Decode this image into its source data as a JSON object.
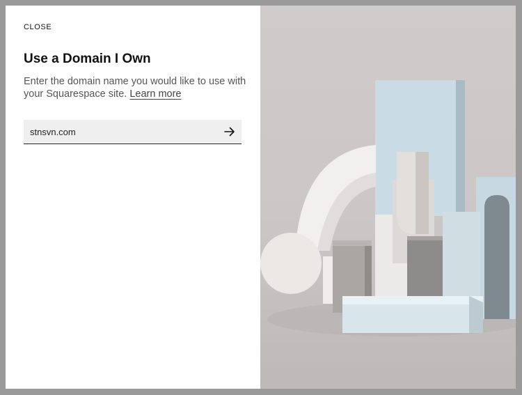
{
  "dialog": {
    "close_label": "CLOSE",
    "title": "Use a Domain I Own",
    "description": "Enter the domain name you would like to use with your Squarespace site.",
    "learn_more_label": "Learn more"
  },
  "domain_input": {
    "value": "stnsvn.com",
    "submit_icon": "arrow-right-icon"
  },
  "illustration": {
    "subject": "sculptural-objects-image"
  },
  "colors": {
    "backdrop": "#9a9a9a",
    "panel": "#ffffff",
    "input_bg": "#efefef",
    "text_primary": "#111111",
    "text_secondary": "#555555"
  }
}
